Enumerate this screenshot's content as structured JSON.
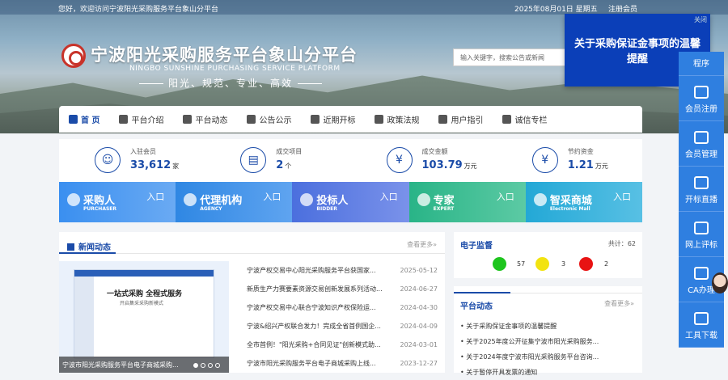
{
  "topbar": {
    "welcome": "您好，欢迎访问宁波阳光采购服务平台象山分平台",
    "date": "2025年08月01日 星期五",
    "register_login": "注册会员"
  },
  "header": {
    "title": "宁波阳光采购服务平台象山分平台",
    "subtitle_en": "NINGBO SUNSHINE PURCHASING SERVICE PLATFORM",
    "slogan": "阳光、规范、专业、高效",
    "search_placeholder": "输入关键字，搜索公告或新闻"
  },
  "popup": {
    "close": "关闭",
    "text": "关于采购保证金事项的温馨提醒"
  },
  "nav": [
    {
      "label": "首 页",
      "icon": "home-icon"
    },
    {
      "label": "平台介绍",
      "icon": "id-card-icon"
    },
    {
      "label": "平台动态",
      "icon": "megaphone-icon"
    },
    {
      "label": "公告公示",
      "icon": "notice-icon"
    },
    {
      "label": "近期开标",
      "icon": "calendar-icon"
    },
    {
      "label": "政策法规",
      "icon": "book-icon"
    },
    {
      "label": "用户指引",
      "icon": "help-icon"
    },
    {
      "label": "诚信专栏",
      "icon": "shield-icon"
    }
  ],
  "stats": [
    {
      "label": "入驻会员",
      "value": "33,612",
      "unit": "家",
      "icon": "users-icon"
    },
    {
      "label": "成交项目",
      "value": "2",
      "unit": "个",
      "icon": "chart-icon"
    },
    {
      "label": "成交金额",
      "value": "103.79",
      "unit": "万元",
      "icon": "yen-icon"
    },
    {
      "label": "节约资金",
      "value": "1.21",
      "unit": "万元",
      "icon": "yen-icon"
    }
  ],
  "portals": [
    {
      "name": "采购人",
      "en": "PURCHASER",
      "entry": "入口"
    },
    {
      "name": "代理机构",
      "en": "AGENCY",
      "entry": "入口"
    },
    {
      "name": "投标人",
      "en": "BIDDER",
      "entry": "入口"
    },
    {
      "name": "专家",
      "en": "EXPERT",
      "entry": "入口"
    },
    {
      "name": "智采商城",
      "en": "Electronic Mall",
      "entry": "入口"
    }
  ],
  "news": {
    "title": "新闻动态",
    "more": "查看更多»",
    "image_big_text": "一站式采购 全程式服务",
    "image_small_text": "开启集采采购新模式",
    "caption": "宁波市阳光采购服务平台电子商城采购...",
    "items": [
      {
        "title": "宁波产权交易中心阳光采购服务平台获国家...",
        "date": "2025-05-12"
      },
      {
        "title": "新质生产力赛要素资源交易创新发展系列活动...",
        "date": "2024-06-27"
      },
      {
        "title": "宁波产权交易中心联合宁波知识产权保险运...",
        "date": "2024-04-30"
      },
      {
        "title": "宁波&绍兴产权联合发力！完成全省首例国企...",
        "date": "2024-04-09"
      },
      {
        "title": "全市首例！\"阳光采购+合同见证\"创新模式助...",
        "date": "2024-03-01"
      },
      {
        "title": "宁波市阳光采购服务平台电子商城采购上线...",
        "date": "2023-12-27"
      }
    ]
  },
  "monitor": {
    "title": "电子监督",
    "total_label": "共计：",
    "total": "62",
    "green": "57",
    "yellow": "3",
    "red": "2"
  },
  "dynamics": {
    "title": "平台动态",
    "more": "查看更多»",
    "items": [
      "• 关于采购保证金事项的温馨提醒",
      "• 关于2025年度公开征集宁波市阳光采购服务...",
      "• 关于2024年度宁波市阳光采购服务平台咨询...",
      "• 关于暂停开具发票的通知"
    ]
  },
  "sidebar": [
    {
      "label": "程序",
      "icon": "app-icon"
    },
    {
      "label": "会员注册",
      "icon": "user-add-icon"
    },
    {
      "label": "会员管理",
      "icon": "user-manage-icon"
    },
    {
      "label": "开标直播",
      "icon": "monitor-icon"
    },
    {
      "label": "网上评标",
      "icon": "review-icon"
    },
    {
      "label": "CA办理",
      "icon": "ca-icon"
    },
    {
      "label": "工具下载",
      "icon": "download-icon"
    }
  ],
  "colors": {
    "primary": "#1a4ba8",
    "popup": "#0b3fb8",
    "sidebar": "#2f7fe0",
    "green": "#1ec51e",
    "yellow": "#f2e310",
    "red": "#e81313"
  }
}
